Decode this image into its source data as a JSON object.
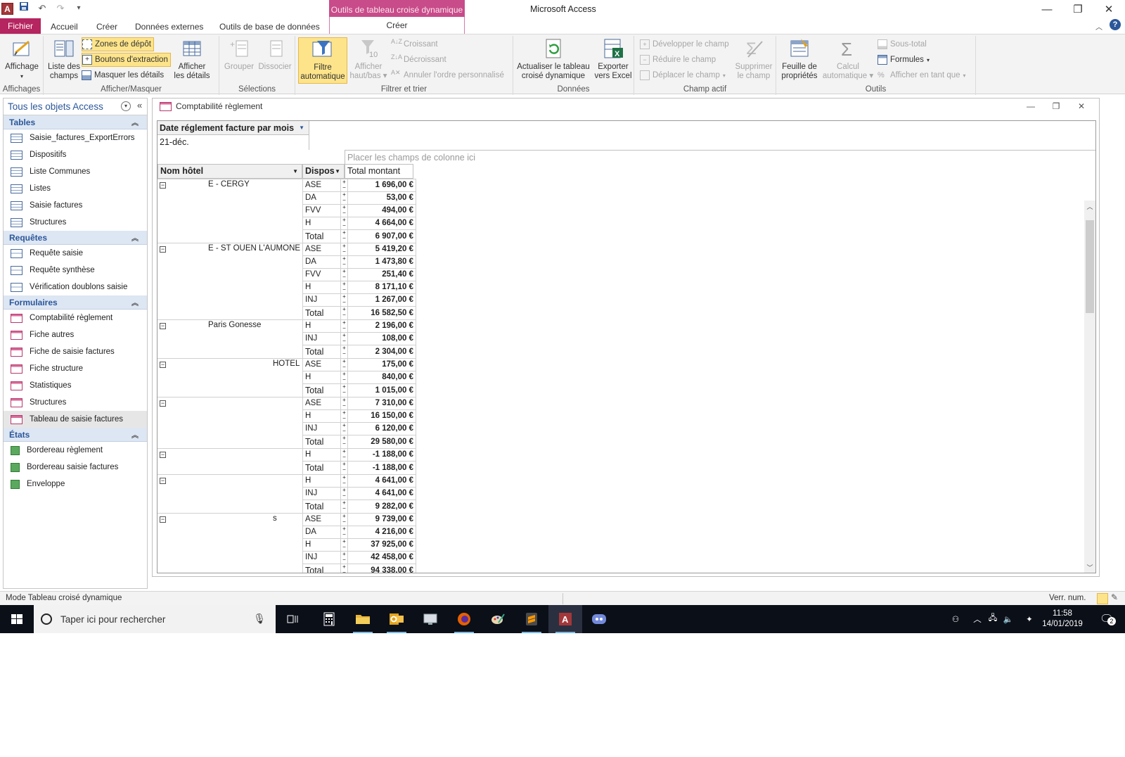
{
  "window": {
    "title": "Microsoft Access",
    "context_header": "Outils de tableau croisé dynamique",
    "app_icon_letter": "A"
  },
  "tabs": {
    "file": "Fichier",
    "home": "Accueil",
    "create": "Créer",
    "external": "Données externes",
    "dbtools": "Outils de base de données",
    "ctx_create": "Créer"
  },
  "ribbon": {
    "views": {
      "affichage": "Affichage",
      "group": "Affichages"
    },
    "show_hide": {
      "field_list_1": "Liste des",
      "field_list_2": "champs",
      "drop_zones": "Zones de dépôt",
      "drill_buttons": "Boutons d'extraction",
      "hide_details": "Masquer les détails",
      "show_details_1": "Afficher",
      "show_details_2": "les détails",
      "group": "Afficher/Masquer"
    },
    "selections": {
      "group_btn": "Grouper",
      "ungroup_btn": "Dissocier",
      "group": "Sélections"
    },
    "filter_sort": {
      "autofilter_1": "Filtre",
      "autofilter_2": "automatique",
      "topbottom_1": "Afficher",
      "topbottom_2": "haut/bas",
      "ascending": "Croissant",
      "descending": "Décroissant",
      "clear_sort": "Annuler l'ordre personnalisé",
      "group": "Filtrer et trier"
    },
    "data": {
      "refresh_1": "Actualiser le tableau",
      "refresh_2": "croisé dynamique",
      "export_1": "Exporter",
      "export_2": "vers Excel",
      "group": "Données"
    },
    "active_field": {
      "expand": "Développer le champ",
      "collapse": "Réduire le champ",
      "move": "Déplacer le champ",
      "delete_1": "Supprimer",
      "delete_2": "le champ",
      "group": "Champ actif"
    },
    "tools": {
      "props_1": "Feuille de",
      "props_2": "propriétés",
      "autocalc_1": "Calcul",
      "autocalc_2": "automatique",
      "subtotal": "Sous-total",
      "formulas": "Formules",
      "show_as": "Afficher en tant que",
      "group": "Outils"
    }
  },
  "nav": {
    "title": "Tous les objets Access",
    "sections": {
      "tables": "Tables",
      "queries": "Requêtes",
      "forms": "Formulaires",
      "reports": "États"
    },
    "tables": [
      "Saisie_factures_ExportErrors",
      "Dispositifs",
      "Liste Communes",
      "Listes",
      "Saisie factures",
      "Structures"
    ],
    "queries": [
      "Requête saisie",
      "Requête synthèse",
      "Vérification doublons saisie"
    ],
    "forms": [
      "Comptabilité règlement",
      "Fiche autres",
      "Fiche de saisie factures",
      "Fiche structure",
      "Statistiques",
      "Structures",
      "Tableau de saisie factures"
    ],
    "reports": [
      "Bordereau règlement",
      "Bordereau saisie factures",
      "Enveloppe"
    ]
  },
  "doc": {
    "title": "Comptabilité règlement"
  },
  "pivot": {
    "filter_field": "Date réglement facture par mois",
    "filter_value": "21-déc.",
    "column_drop": "Placer les champs de colonne ici",
    "row_header_1": "Nom hôtel",
    "row_header_2": "Dispos",
    "data_header": "Total montant",
    "groups": [
      {
        "name": "E - CERGY",
        "rows": [
          [
            "ASE",
            "1 696,00 €"
          ],
          [
            "DA",
            "53,00 €"
          ],
          [
            "FVV",
            "494,00 €"
          ],
          [
            "H",
            "4 664,00 €"
          ],
          [
            "Total",
            "6 907,00 €"
          ]
        ]
      },
      {
        "name": "E - ST OUEN L'AUMONE",
        "rows": [
          [
            "ASE",
            "5 419,20 €"
          ],
          [
            "DA",
            "1 473,80 €"
          ],
          [
            "FVV",
            "251,40 €"
          ],
          [
            "H",
            "8 171,10 €"
          ],
          [
            "INJ",
            "1 267,00 €"
          ],
          [
            "Total",
            "16 582,50 €"
          ]
        ]
      },
      {
        "name": "Paris Gonesse",
        "rows": [
          [
            "H",
            "2 196,00 €"
          ],
          [
            "INJ",
            "108,00 €"
          ],
          [
            "Total",
            "2 304,00 €"
          ]
        ]
      },
      {
        "name": "HOTEL",
        "rows": [
          [
            "ASE",
            "175,00 €"
          ],
          [
            "H",
            "840,00 €"
          ],
          [
            "Total",
            "1 015,00 €"
          ]
        ]
      },
      {
        "name": "",
        "rows": [
          [
            "ASE",
            "7 310,00 €"
          ],
          [
            "H",
            "16 150,00 €"
          ],
          [
            "INJ",
            "6 120,00 €"
          ],
          [
            "Total",
            "29 580,00 €"
          ]
        ]
      },
      {
        "name": "",
        "rows": [
          [
            "H",
            "-1 188,00 €"
          ],
          [
            "Total",
            "-1 188,00 €"
          ]
        ]
      },
      {
        "name": "",
        "rows": [
          [
            "H",
            "4 641,00 €"
          ],
          [
            "INJ",
            "4 641,00 €"
          ],
          [
            "Total",
            "9 282,00 €"
          ]
        ]
      },
      {
        "name": "s",
        "rows": [
          [
            "ASE",
            "9 739,00 €"
          ],
          [
            "DA",
            "4 216,00 €"
          ],
          [
            "H",
            "37 925,00 €"
          ],
          [
            "INJ",
            "42 458,00 €"
          ],
          [
            "Total",
            "94 338,00 €"
          ]
        ]
      }
    ]
  },
  "status": {
    "mode": "Mode Tableau croisé dynamique",
    "numlock": "Verr. num."
  },
  "taskbar": {
    "search_placeholder": "Taper ici pour rechercher",
    "time": "11:58",
    "date": "14/01/2019",
    "notifications": "2"
  }
}
